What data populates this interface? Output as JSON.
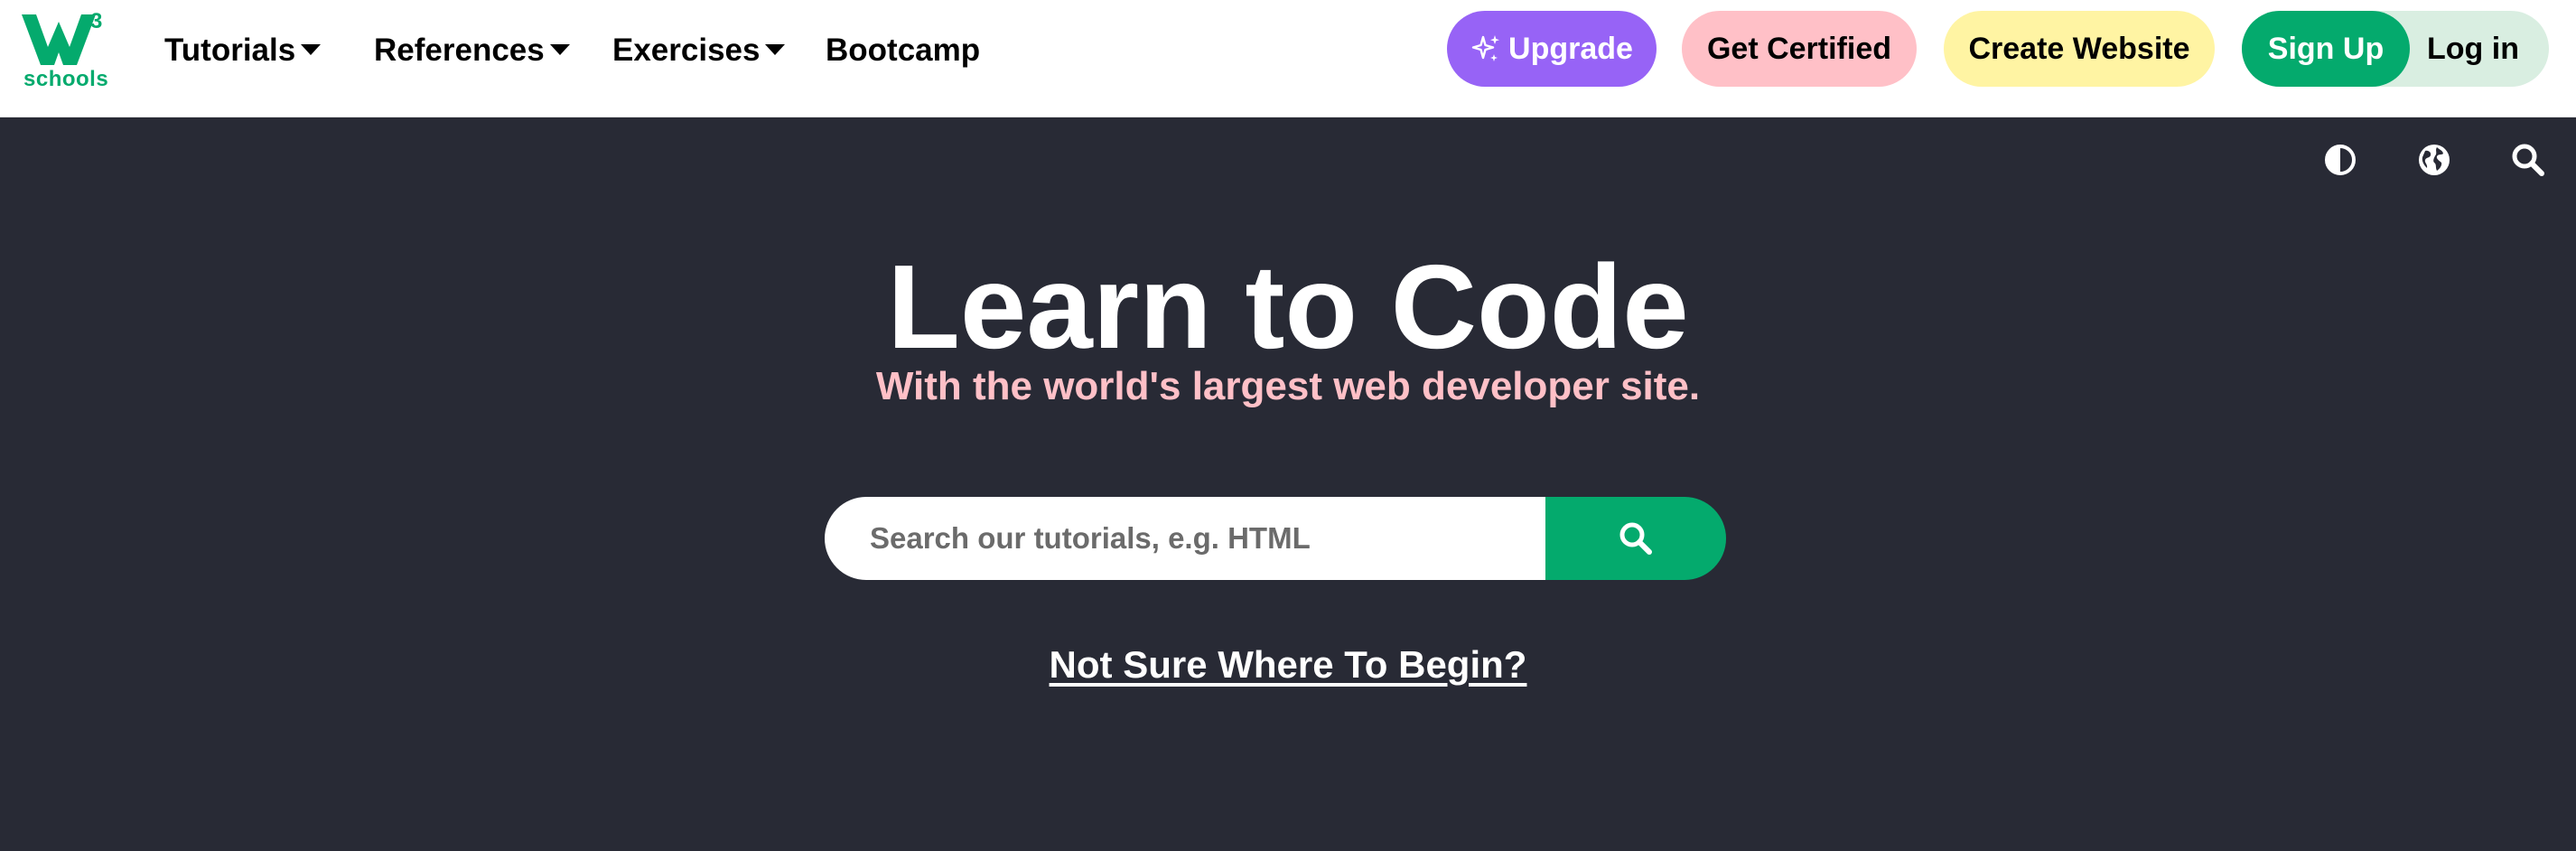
{
  "logo": {
    "mark": "W",
    "superscript": "3",
    "wordmark": "schools",
    "color": "#04AA6D"
  },
  "nav": {
    "items": [
      {
        "label": "Tutorials",
        "dropdown": true
      },
      {
        "label": "References",
        "dropdown": true
      },
      {
        "label": "Exercises",
        "dropdown": true
      },
      {
        "label": "Bootcamp",
        "dropdown": false
      }
    ]
  },
  "actions": {
    "upgrade_label": "Upgrade",
    "certified_label": "Get Certified",
    "create_site_label": "Create Website",
    "signup_label": "Sign Up",
    "login_label": "Log in"
  },
  "utility_icons": [
    "contrast-icon",
    "globe-icon",
    "search-icon"
  ],
  "hero": {
    "title": "Learn to Code",
    "subtitle": "With the world's largest web developer site.",
    "search_placeholder": "Search our tutorials, e.g. HTML",
    "link_text": "Not Sure Where To Begin?"
  },
  "colors": {
    "brand_green": "#04AA6D",
    "hero_bg": "#282A35",
    "upgrade_purple": "#9763F6",
    "certified_pink": "#FFC0C7",
    "create_yellow": "#FFF4A3",
    "login_bg": "#D9EEE1",
    "subtitle_pink": "#FFC0C7"
  }
}
